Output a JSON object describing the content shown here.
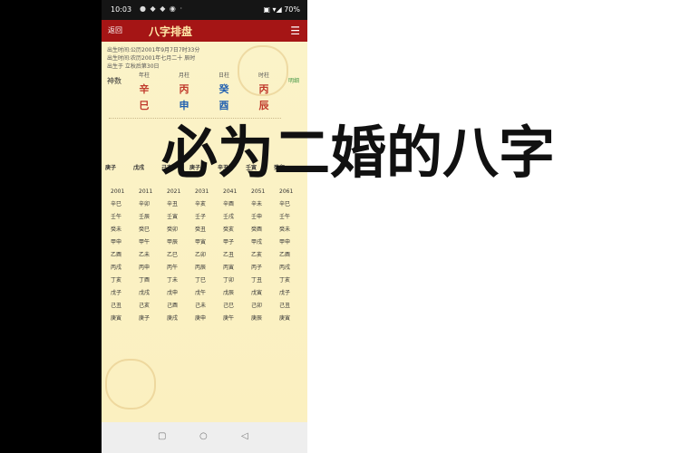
{
  "status_bar": {
    "time": "10:03",
    "icons": "● ◆ ◆ ◉ ·",
    "right": "▣ ▾◢ 70%"
  },
  "app": {
    "back_label": "返回",
    "title": "八字排盘",
    "menu_icon": "menu-icon"
  },
  "info": [
    "出生时间:公历2001年9月7日7时33分",
    "出生时间:农历2001年七月二十 辰时",
    "出生于 立秋后第30日"
  ],
  "pillars": {
    "headers": [
      "年柱",
      "月柱",
      "日柱",
      "时柱"
    ],
    "stems": [
      "辛",
      "丙",
      "癸",
      "丙"
    ],
    "branches": [
      "巳",
      "申",
      "酉",
      "辰"
    ],
    "row_label": "神数",
    "tag": "明细"
  },
  "dayun_header": [
    "庚子",
    "戊戌",
    "己亥",
    "庚子",
    "辛丑",
    "壬寅",
    "癸卯"
  ],
  "dayun_years": [
    "2001",
    "2011",
    "2021",
    "2031",
    "2041",
    "2051",
    "2061"
  ],
  "liunian_rows": [
    [
      "辛巳",
      "辛卯",
      "辛丑",
      "辛亥",
      "辛酉",
      "辛未",
      "辛巳"
    ],
    [
      "壬午",
      "壬辰",
      "壬寅",
      "壬子",
      "壬戌",
      "壬申",
      "壬午"
    ],
    [
      "癸未",
      "癸巳",
      "癸卯",
      "癸丑",
      "癸亥",
      "癸酉",
      "癸未"
    ],
    [
      "甲申",
      "甲午",
      "甲辰",
      "甲寅",
      "甲子",
      "甲戌",
      "甲申"
    ],
    [
      "乙酉",
      "乙未",
      "乙巳",
      "乙卯",
      "乙丑",
      "乙亥",
      "乙酉"
    ],
    [
      "丙戌",
      "丙申",
      "丙午",
      "丙辰",
      "丙寅",
      "丙子",
      "丙戌"
    ],
    [
      "丁亥",
      "丁酉",
      "丁未",
      "丁巳",
      "丁卯",
      "丁丑",
      "丁亥"
    ],
    [
      "戊子",
      "戊戌",
      "戊申",
      "戊午",
      "戊辰",
      "戊寅",
      "戊子"
    ],
    [
      "己丑",
      "己亥",
      "己酉",
      "己未",
      "己巳",
      "己卯",
      "己丑"
    ],
    [
      "庚寅",
      "庚子",
      "庚戌",
      "庚申",
      "庚午",
      "庚辰",
      "庚寅"
    ]
  ],
  "headline": "必为二婚的八字",
  "colors": {
    "appbar": "#a51515",
    "background": "#fbf3c8",
    "stem_accent": "#c0392b",
    "branch_accent": "#1f5fb0"
  }
}
